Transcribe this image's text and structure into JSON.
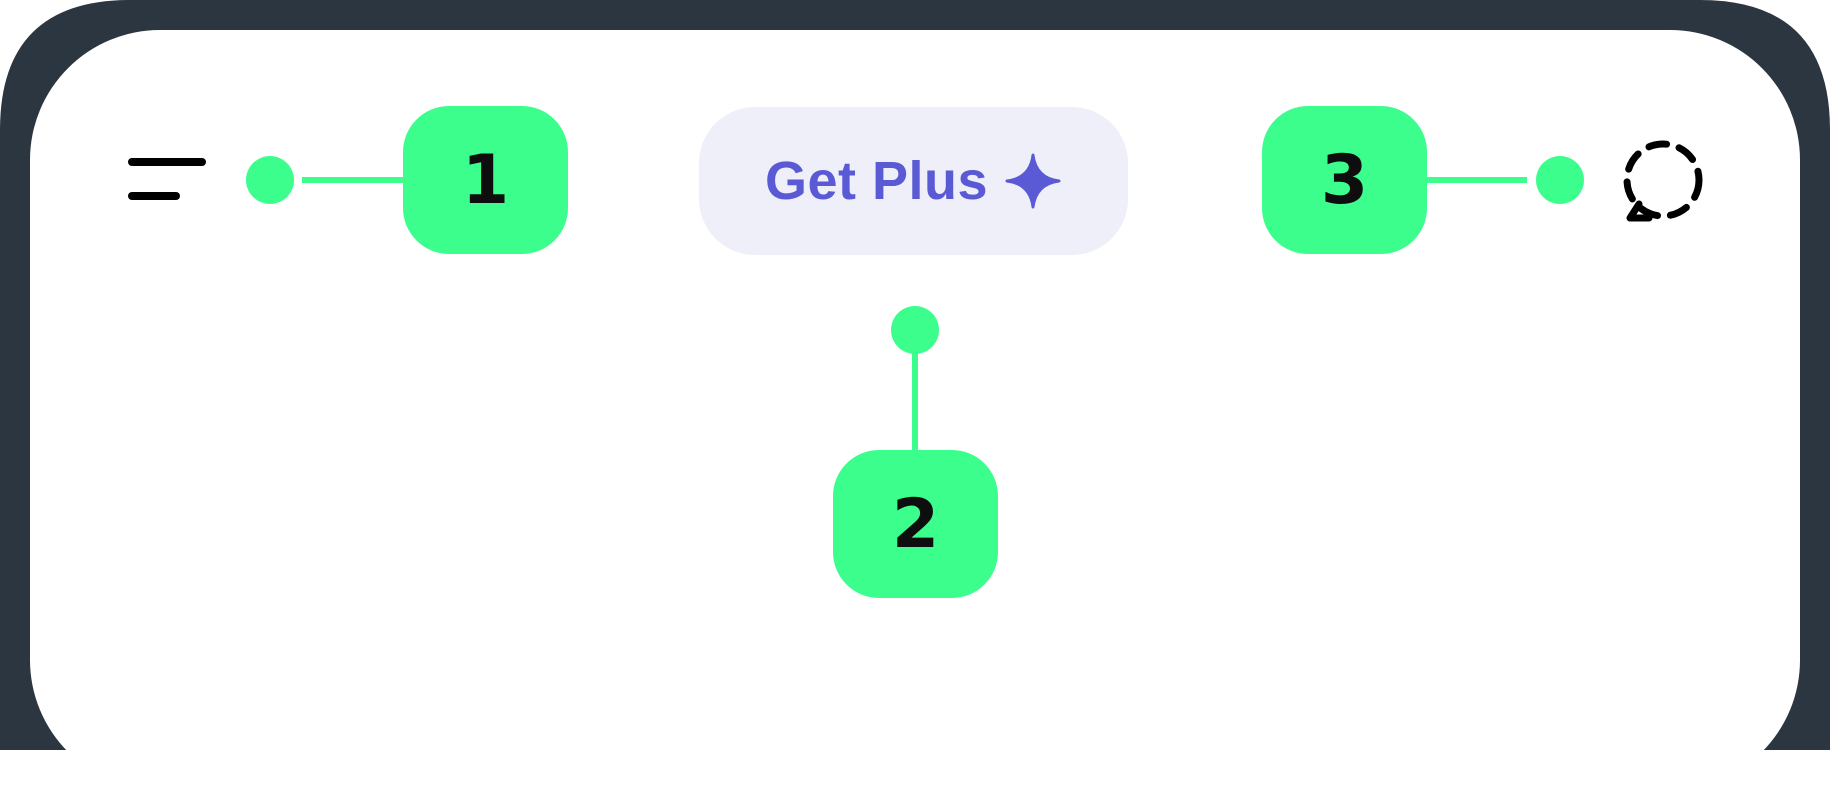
{
  "header": {
    "upgrade_button": {
      "label": "Get Plus",
      "icon": "sparkle-icon"
    },
    "menu_icon": "menu-icon",
    "chat_icon": "dashed-chat-icon"
  },
  "annotations": [
    {
      "number": "1",
      "target": "menu-icon"
    },
    {
      "number": "2",
      "target": "upgrade-button"
    },
    {
      "number": "3",
      "target": "dashed-chat-icon"
    }
  ],
  "colors": {
    "frame": "#2b3640",
    "screen": "#ffffff",
    "annotation": "#3cfe8d",
    "button_bg": "#efeff9",
    "button_text": "#5a5bd4"
  }
}
